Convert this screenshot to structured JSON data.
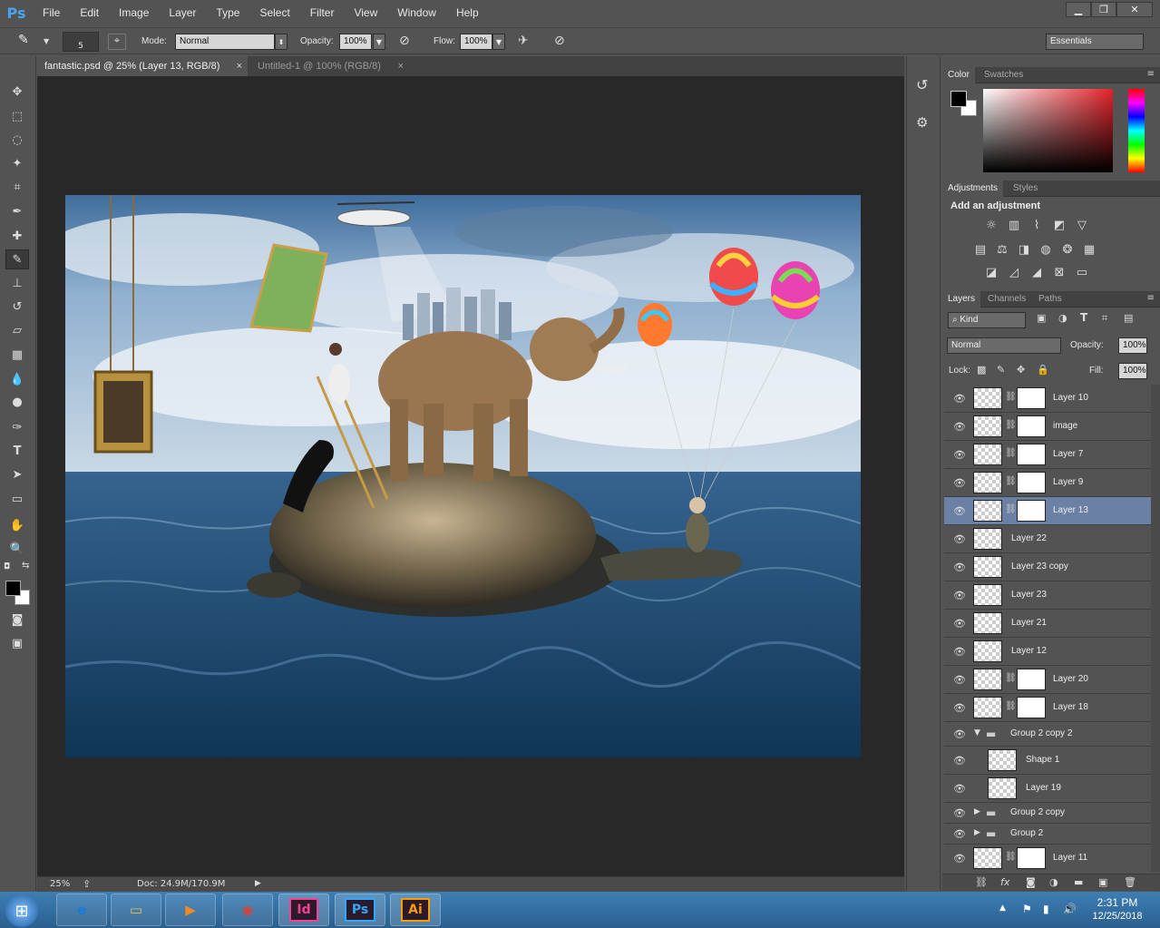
{
  "app": {
    "logo": "Ps"
  },
  "menu": [
    "File",
    "Edit",
    "Image",
    "Layer",
    "Type",
    "Select",
    "Filter",
    "View",
    "Window",
    "Help"
  ],
  "window_controls": {
    "minimize": "▁",
    "restore": "❐",
    "close": "✕"
  },
  "options": {
    "brush_size": "5",
    "mode_label": "Mode:",
    "mode_value": "Normal",
    "opacity_label": "Opacity:",
    "opacity_value": "100%",
    "flow_label": "Flow:",
    "flow_value": "100%",
    "workspace": "Essentials"
  },
  "tabs": [
    {
      "label": "fantastic.psd @ 25% (Layer 13, RGB/8)",
      "close": "×",
      "active": true
    },
    {
      "label": "Untitled-1 @ 100% (RGB/8)",
      "close": "×",
      "active": false
    }
  ],
  "status": {
    "zoom": "25%",
    "doc": "Doc: 24.9M/170.9M"
  },
  "color_panel": {
    "tabs": [
      "Color",
      "Swatches"
    ]
  },
  "adjustments_panel": {
    "tabs": [
      "Adjustments",
      "Styles"
    ],
    "heading": "Add an adjustment"
  },
  "layers_panel": {
    "tabs": [
      "Layers",
      "Channels",
      "Paths"
    ],
    "filter": "Kind",
    "blend_mode": "Normal",
    "opacity_label": "Opacity:",
    "opacity_value": "100%",
    "lock_label": "Lock:",
    "fill_label": "Fill:",
    "fill_value": "100%",
    "layers": [
      {
        "name": "Layer 10",
        "mask": true,
        "selected": false,
        "type": "layer"
      },
      {
        "name": "image",
        "mask": true,
        "selected": false,
        "type": "layer"
      },
      {
        "name": "Layer 7",
        "mask": true,
        "selected": false,
        "type": "layer"
      },
      {
        "name": "Layer 9",
        "mask": true,
        "selected": false,
        "type": "layer"
      },
      {
        "name": "Layer 13",
        "mask": true,
        "selected": true,
        "type": "layer"
      },
      {
        "name": "Layer 22",
        "mask": false,
        "selected": false,
        "type": "layer"
      },
      {
        "name": "Layer 23 copy",
        "mask": false,
        "selected": false,
        "type": "layer"
      },
      {
        "name": "Layer 23",
        "mask": false,
        "selected": false,
        "type": "layer"
      },
      {
        "name": "Layer 21",
        "mask": false,
        "selected": false,
        "type": "layer"
      },
      {
        "name": "Layer 12",
        "mask": false,
        "selected": false,
        "type": "layer"
      },
      {
        "name": "Layer 20",
        "mask": true,
        "selected": false,
        "type": "layer"
      },
      {
        "name": "Layer 18",
        "mask": true,
        "selected": false,
        "type": "layer"
      },
      {
        "name": "Group 2 copy 2",
        "mask": false,
        "selected": false,
        "type": "group-open"
      },
      {
        "name": "Shape 1",
        "mask": false,
        "selected": false,
        "type": "child"
      },
      {
        "name": "Layer 19",
        "mask": false,
        "selected": false,
        "type": "child"
      },
      {
        "name": "Group 2 copy",
        "mask": false,
        "selected": false,
        "type": "group"
      },
      {
        "name": "Group 2",
        "mask": false,
        "selected": false,
        "type": "group"
      },
      {
        "name": "Layer 11",
        "mask": true,
        "selected": false,
        "type": "layer"
      }
    ]
  },
  "taskbar": {
    "apps": [
      {
        "name": "internet-explorer",
        "glyph": "e",
        "color": "#1a7bd6"
      },
      {
        "name": "file-explorer",
        "glyph": "▭",
        "color": "#e8c24a"
      },
      {
        "name": "media-player",
        "glyph": "▶",
        "color": "#f08a24"
      },
      {
        "name": "chrome",
        "glyph": "◉",
        "color": "#d94235"
      },
      {
        "name": "indesign",
        "glyph": "Id",
        "color": "#fd3f93"
      },
      {
        "name": "photoshop",
        "glyph": "Ps",
        "color": "#31a8ff"
      },
      {
        "name": "illustrator",
        "glyph": "Ai",
        "color": "#ff9a00"
      }
    ],
    "time": "2:31 PM",
    "date": "12/25/2018"
  },
  "colors": {
    "accent": "#4aa3ef",
    "selected_layer": "#6a80a5"
  }
}
